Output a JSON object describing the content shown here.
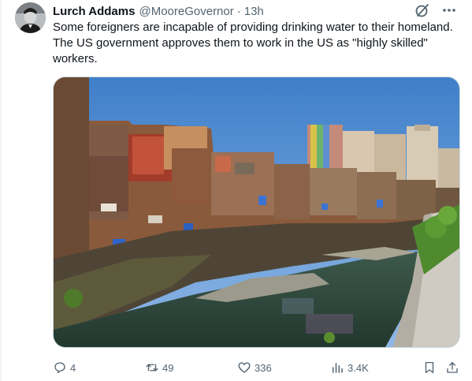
{
  "tweet": {
    "author_name": "Lurch Addams",
    "handle": "@MooreGovernor",
    "separator": "·",
    "time": "13h",
    "text": "Some foreigners are incapable of providing drinking water to their homeland.  The US government approves them to work in the US as \"highly skilled\" workers.",
    "icons": [
      "grok-icon",
      "more-icon"
    ]
  },
  "actions": {
    "replies": "4",
    "reposts": "49",
    "likes": "336",
    "views": "3.4K",
    "icons": [
      "reply-icon",
      "repost-icon",
      "like-icon",
      "views-icon",
      "bookmark-icon",
      "share-icon"
    ]
  },
  "colors": {
    "text": "#0f1419",
    "secondary": "#536471",
    "border": "#cfd9de"
  }
}
